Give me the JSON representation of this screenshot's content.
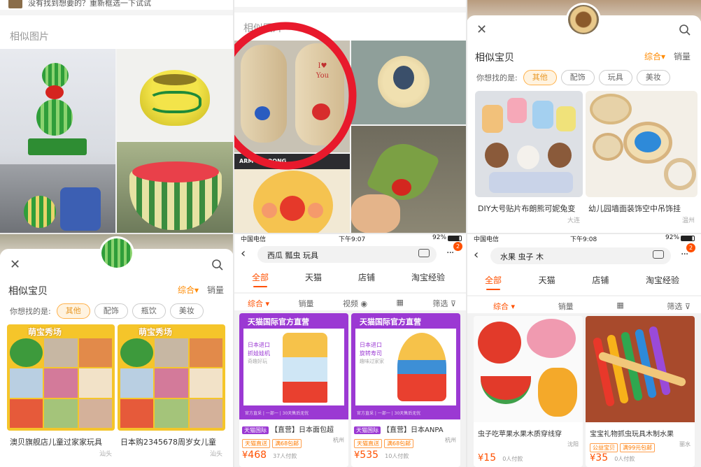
{
  "panel1": {
    "top_hint": "没有找到想要的？重新框选一下试试",
    "section_title": "相似图片"
  },
  "panel2": {
    "section_title": "相似图片",
    "poster_text": "ARM STROONG"
  },
  "panel3": {
    "title": "相似宝贝",
    "sort_label": "综合",
    "sales_label": "销量",
    "hint_label": "你想找的是:",
    "chips": [
      "其他",
      "配饰",
      "玩具",
      "美妆"
    ],
    "products": [
      {
        "title": "DIY大号贴片布朗熊可妮兔变",
        "location": "大连"
      },
      {
        "title": "幼儿园墙面装饰空中吊饰挂",
        "location": "温州"
      }
    ]
  },
  "panel4": {
    "title": "相似宝贝",
    "sort_label": "综合",
    "sales_label": "销量",
    "hint_label": "你想找的是:",
    "chips": [
      "其他",
      "配饰",
      "瓶饮",
      "美妆"
    ],
    "banner_text": "萌宝秀场",
    "products": [
      {
        "title": "澳贝旗舰店儿童过家家玩具",
        "location": "汕头"
      },
      {
        "title": "日本购2345678周岁女儿童",
        "location": "汕头"
      }
    ]
  },
  "panel5": {
    "status": {
      "carrier": "中国电信",
      "time": "下午9:07",
      "battery": "92%"
    },
    "search_text": "西瓜 瓢虫 玩具",
    "badge": "2",
    "tabs": [
      "全部",
      "天猫",
      "店铺",
      "淘宝经验"
    ],
    "filters": [
      "综合",
      "销量",
      "视频",
      "筛选"
    ],
    "products": [
      {
        "banner": "天猫国际官方直营",
        "subtitle": "日本进口",
        "subtitle2": "抓娃娃机",
        "subtitle3": "奇趣好玩",
        "footer": "官方直采 | 一部一 | 30天售后无忧",
        "badge": "天猫国际",
        "title": "【直营】日本面包超",
        "tags": [
          "天猫直送",
          "满68包邮"
        ],
        "location": "杭州",
        "price": "468",
        "sold": "37人付款"
      },
      {
        "banner": "天猫国际官方直营",
        "subtitle": "日本进口",
        "subtitle2": "旋转寿司",
        "subtitle3": "趣味过家家",
        "footer": "官方直采 | 一部一 | 30天售后无忧",
        "badge": "天猫国际",
        "title": "【直营】日本ANPA",
        "tags": [
          "天猫直送",
          "满68包邮"
        ],
        "location": "杭州",
        "price": "535",
        "sold": "10人付款"
      }
    ]
  },
  "panel6": {
    "status": {
      "carrier": "中国电信",
      "time": "下午9:08",
      "battery": "92%"
    },
    "search_text": "水果 虫子 木",
    "badge": "2",
    "tabs": [
      "全部",
      "天猫",
      "店铺",
      "淘宝经验"
    ],
    "filters": [
      "综合",
      "销量",
      "筛选"
    ],
    "products": [
      {
        "title": "虫子吃苹果水果木质穿线穿",
        "location": "沈阳",
        "price": "15",
        "sold": "0人付款"
      },
      {
        "title": "宝宝礼物抓虫玩具木制水果",
        "tags": [
          "公益宝贝",
          "满99元包邮"
        ],
        "location": "丽水",
        "price": "35",
        "sold": "0人付款"
      }
    ]
  },
  "colors": {
    "accent": "#ff5000",
    "highlight_ring": "#e8192c"
  }
}
